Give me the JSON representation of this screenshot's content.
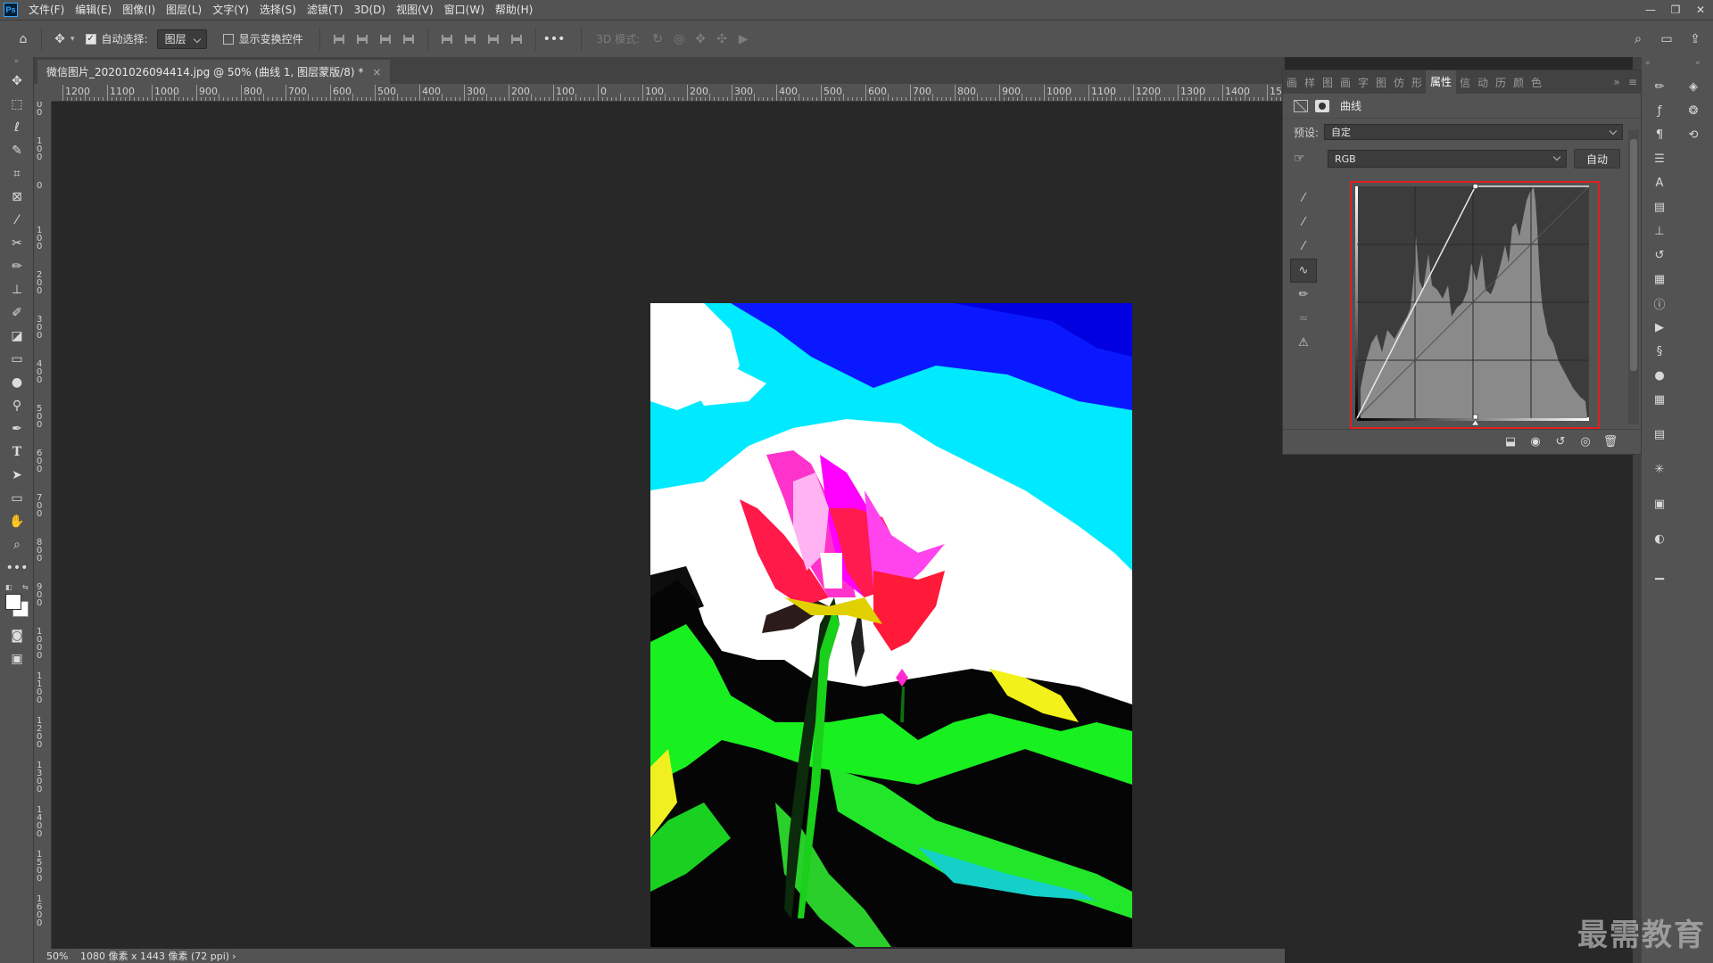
{
  "app": {
    "logo": "Ps"
  },
  "menu": [
    "文件(F)",
    "编辑(E)",
    "图像(I)",
    "图层(L)",
    "文字(Y)",
    "选择(S)",
    "滤镜(T)",
    "3D(D)",
    "视图(V)",
    "窗口(W)",
    "帮助(H)"
  ],
  "window_controls": {
    "minimize": "—",
    "restore": "❐",
    "close": "✕"
  },
  "options": {
    "home_icon": "⌂",
    "move_icon": "✥",
    "auto_select_label": "自动选择:",
    "auto_select_checked": "✓",
    "target_value": "图层",
    "show_transform_label": "显示变换控件",
    "more_label": "•••",
    "mode3d_label": "3D 模式:",
    "search_icon": "⌕",
    "workspace_icon": "▭",
    "share_icon": "⇪"
  },
  "document": {
    "tab_title": "微信图片_20201026094414.jpg @ 50% (曲线 1, 图层蒙版/8) *",
    "close_glyph": "×"
  },
  "ruler": {
    "h_labels": [
      "1200",
      "1100",
      "1000",
      "900",
      "800",
      "700",
      "600",
      "500",
      "400",
      "300",
      "200",
      "100",
      "0",
      "100",
      "200",
      "300",
      "400",
      "500",
      "600",
      "700",
      "800",
      "900",
      "1000",
      "1100",
      "1200",
      "1300",
      "1400",
      "15"
    ],
    "v_labels": [
      "2 0 0",
      "1 0 0",
      "0",
      "1 0 0",
      "2 0 0",
      "3 0 0",
      "4 0 0",
      "5 0 0",
      "6 0 0",
      "7 0 0",
      "8 0 0",
      "9 0 0",
      "1 0 0 0",
      "1 1 0 0",
      "1 2 0 0",
      "1 3 0 0",
      "1 4 0 0",
      "1 5 0 0",
      "1 6 0 0"
    ]
  },
  "status": {
    "zoom": "50%",
    "info": "1080 像素 x 1443 像素 (72 ppi)",
    "arrow": "›"
  },
  "properties": {
    "tabs": [
      "画",
      "样",
      "图",
      "画",
      "字",
      "图",
      "仿",
      "形",
      "属性",
      "信",
      "动",
      "历",
      "颜",
      "色"
    ],
    "active_tab": "属性",
    "collapse_icon": "»",
    "menu_icon": "≡",
    "title": "曲线",
    "preset_label": "预设:",
    "preset_value": "自定",
    "channel_value": "RGB",
    "auto_button": "自动",
    "footer_icons": [
      "clip-icon",
      "view-previous-icon",
      "reset-icon",
      "visibility-icon",
      "delete-icon"
    ]
  },
  "curve": {
    "input_black": 0.0,
    "input_white": 0.51,
    "output_black": 0.0,
    "output_white": 1.0
  },
  "watermark": "最需教育",
  "colors": {
    "accent_red": "#e02020",
    "panel": "#535353",
    "canvas": "#282828"
  }
}
